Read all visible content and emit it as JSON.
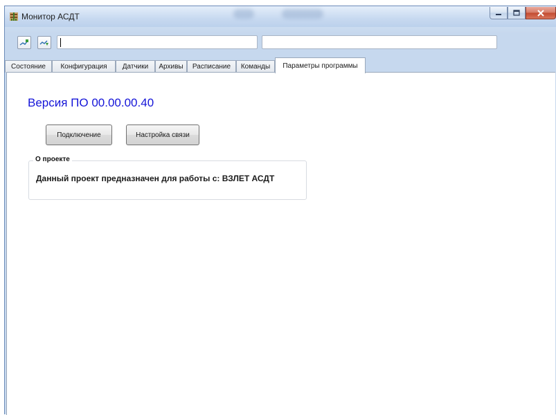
{
  "window": {
    "title": "Монитор АСДТ",
    "accent": "#1515d8"
  },
  "window_controls": {
    "minimize_icon": "minimize-icon",
    "maximize_icon": "maximize-icon",
    "close_icon": "close-icon"
  },
  "toolbar": {
    "button1_icon": "connect-chart-icon",
    "button2_icon": "download-chart-icon",
    "input1_value": "",
    "input2_value": ""
  },
  "tabs": [
    {
      "label": "Состояние",
      "active": false
    },
    {
      "label": "Конфигурация",
      "active": false
    },
    {
      "label": "Датчики",
      "active": false
    },
    {
      "label": "Архивы",
      "active": false
    },
    {
      "label": "Расписание",
      "active": false
    },
    {
      "label": "Команды",
      "active": false
    },
    {
      "label": "Параметры программы",
      "active": true
    }
  ],
  "main": {
    "version_text": "Версия ПО 00.00.00.40",
    "connect_button": "Подключение",
    "link_settings_button": "Настройка связи",
    "about_group": {
      "legend": "О проекте",
      "text": "Данный проект предназначен для работы с: ВЗЛЕТ АСДТ"
    }
  }
}
